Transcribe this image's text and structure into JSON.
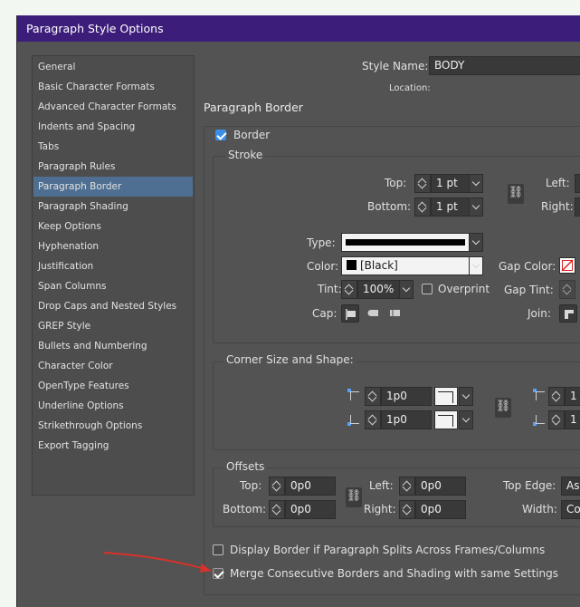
{
  "window": {
    "title": "Paragraph Style Options"
  },
  "sidebar": {
    "items": [
      {
        "label": "General",
        "selected": false
      },
      {
        "label": "Basic Character Formats",
        "selected": false
      },
      {
        "label": "Advanced Character Formats",
        "selected": false
      },
      {
        "label": "Indents and Spacing",
        "selected": false
      },
      {
        "label": "Tabs",
        "selected": false
      },
      {
        "label": "Paragraph Rules",
        "selected": false
      },
      {
        "label": "Paragraph Border",
        "selected": true
      },
      {
        "label": "Paragraph Shading",
        "selected": false
      },
      {
        "label": "Keep Options",
        "selected": false
      },
      {
        "label": "Hyphenation",
        "selected": false
      },
      {
        "label": "Justification",
        "selected": false
      },
      {
        "label": "Span Columns",
        "selected": false
      },
      {
        "label": "Drop Caps and Nested Styles",
        "selected": false
      },
      {
        "label": "GREP Style",
        "selected": false
      },
      {
        "label": "Bullets and Numbering",
        "selected": false
      },
      {
        "label": "Character Color",
        "selected": false
      },
      {
        "label": "OpenType Features",
        "selected": false
      },
      {
        "label": "Underline Options",
        "selected": false
      },
      {
        "label": "Strikethrough Options",
        "selected": false
      },
      {
        "label": "Export Tagging",
        "selected": false
      }
    ]
  },
  "header": {
    "style_name_label": "Style Name:",
    "style_name_value": "BODY",
    "location_label": "Location:"
  },
  "section_title": "Paragraph Border",
  "border": {
    "checkbox_label": "Border",
    "checked": true,
    "stroke": {
      "title": "Stroke",
      "top_label": "Top:",
      "top_value": "1 pt",
      "bottom_label": "Bottom:",
      "bottom_value": "1 pt",
      "left_label": "Left:",
      "right_label": "Right:",
      "type_label": "Type:",
      "color_label": "Color:",
      "color_value": "[Black]",
      "gap_color_label": "Gap Color:",
      "tint_label": "Tint:",
      "tint_value": "100%",
      "overprint_label": "Overprint",
      "gap_tint_label": "Gap Tint:",
      "cap_label": "Cap:",
      "join_label": "Join:"
    },
    "corner": {
      "title": "Corner Size and Shape:",
      "top_left_value": "1p0",
      "bottom_left_value": "1p0",
      "top_right_value": "1",
      "bottom_right_value": "1"
    },
    "offsets": {
      "title": "Offsets",
      "top_label": "Top:",
      "top_value": "0p0",
      "bottom_label": "Bottom:",
      "bottom_value": "0p0",
      "left_label": "Left:",
      "left_value": "0p0",
      "right_label": "Right:",
      "right_value": "0p0",
      "top_edge_label": "Top Edge:",
      "top_edge_value": "As",
      "width_label": "Width:",
      "width_value": "Co"
    },
    "display_split_label": "Display Border if Paragraph Splits Across Frames/Columns",
    "display_split_checked": false,
    "merge_label": "Merge Consecutive Borders and Shading with same Settings",
    "merge_checked": true
  },
  "colors": {
    "titlebar": "#3c1d7a",
    "panel": "#535353",
    "selection": "#4e6f91",
    "checkbox_on": "#3b8ee8",
    "annotation_arrow": "#d8322a"
  }
}
